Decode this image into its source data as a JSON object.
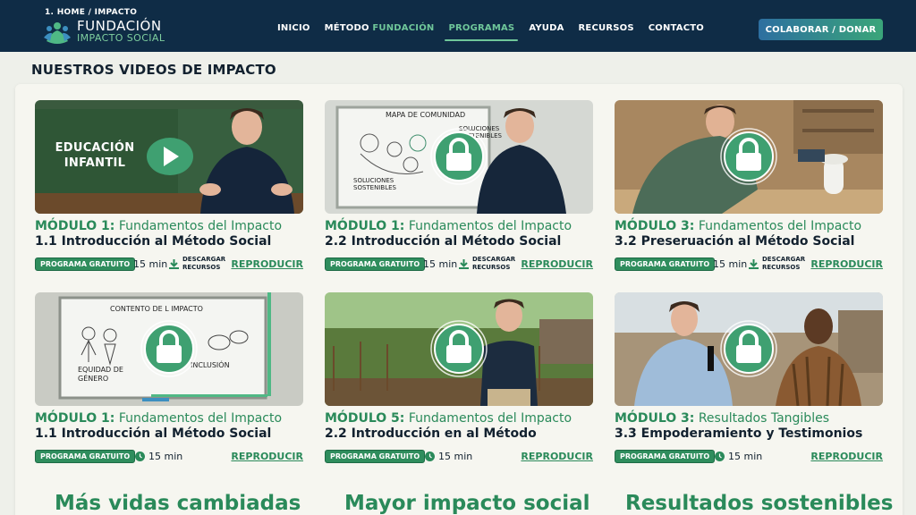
{
  "header": {
    "breadcrumb": "1. HOME / IMPACTO",
    "logo_line1": "FUNDACIÓN",
    "logo_line2": "IMPACTO SOCIAL",
    "nav": [
      {
        "label": "INICIO"
      },
      {
        "label_a": "MÉTODO",
        "label_b": "FUNDACIÓN"
      },
      {
        "label": "PROGRAMAS",
        "active": true
      },
      {
        "label": "AYUDA"
      },
      {
        "label": "RECURSOS"
      },
      {
        "label": "CONTACTO"
      }
    ],
    "cta_label": "COLABORAR / DONAR"
  },
  "section_title": "NUESTROS VIDEOS DE IMPACTO",
  "cards": [
    {
      "module_prefix": "MÓDULO 1:",
      "module_name": "Fundamentos del Impacto",
      "lesson": "1.1 Introducción al Método Social",
      "badge": "PROGRAMA GRATUITO",
      "duration": "15 min",
      "download": "DESCARGAR RECURSOS",
      "action": "REPRODUCIR",
      "thumb_label": "EDUCACIÓN INFANTIL",
      "locked": false,
      "icon": "play-icon"
    },
    {
      "module_prefix": "MÓDULO 1:",
      "module_name": "Fundamentos del Impacto",
      "lesson": "2.2 Introducción al Método Social",
      "badge": "PROGRAMA GRATUITO",
      "duration": "15 min",
      "download": "DESCARGAR RECURSOS",
      "action": "REPRODUCIR",
      "board_title": "MAPA DE COMUNIDAD",
      "board_note1": "SOLUCIONES SOSTENIBLES",
      "board_note2": "SOLUCIONES SOSTENIBLES",
      "locked": true,
      "icon": "lock-icon"
    },
    {
      "module_prefix": "MÓDULO 3:",
      "module_name": "Fundamentos del Impacto",
      "lesson": "3.2 Preseruación al Método Social",
      "badge": "PROGRAMA GRATUITO",
      "duration": "15 min",
      "download": "DESCARGAR RECURSOS",
      "action": "REPRODUCIR",
      "locked": true,
      "icon": "lock-icon"
    },
    {
      "module_prefix": "MÓDULO 1:",
      "module_name": "Fundamentos del Impacto",
      "lesson": "1.1 Introducción al Método Social",
      "badge": "PROGRAMA GRATUITO",
      "duration": "15 min",
      "action": "REPRODUCIR",
      "board_title": "CONTENTO DE L IMPACTO",
      "board_note1": "EQUIDAD DE GÉNERO",
      "board_note2": "INCLUSIÓN",
      "locked": true,
      "icon": "lock-icon"
    },
    {
      "module_prefix": "MÓDULO 5:",
      "module_name": "Fundamentos del Impacto",
      "lesson": "2.2 Introducción en al Método",
      "badge": "PROGRAMA GRATUITO",
      "duration": "15 min",
      "action": "REPRODUCIR",
      "locked": true,
      "icon": "lock-icon"
    },
    {
      "module_prefix": "MÓDULO 3:",
      "module_name": "Resultados Tangibles",
      "lesson": "3.3 Empoderamiento y Testimonios",
      "badge": "PROGRAMA GRATUITO",
      "duration": "15 min",
      "action": "REPRODUCIR",
      "locked": true,
      "icon": "lock-icon"
    }
  ],
  "stats": [
    "Más vidas cambiadas",
    "Mayor impacto social",
    "Resultados sostenibles"
  ],
  "colors": {
    "navy": "#0f2c46",
    "green": "#2a8a5a",
    "accent_green": "#6fc79a",
    "badge": "#2f8d5d"
  }
}
